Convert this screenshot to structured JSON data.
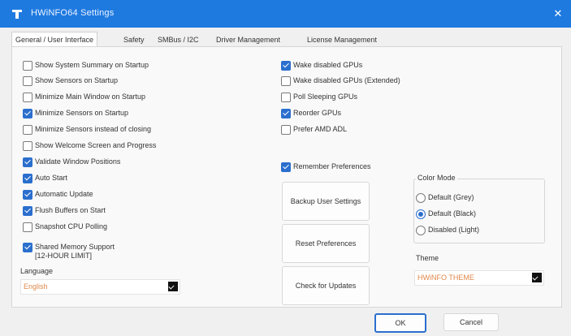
{
  "window": {
    "title": "HWiNFO64 Settings",
    "close_glyph": "✕",
    "accent": "#1f7ae0"
  },
  "tabs": [
    {
      "label": "General / User Interface"
    },
    {
      "label": "Safety"
    },
    {
      "label": "SMBus / I2C"
    },
    {
      "label": "Driver Management"
    },
    {
      "label": "License Management"
    }
  ],
  "left_options": [
    {
      "label": "Show System Summary on Startup",
      "checked": false
    },
    {
      "label": "Show Sensors on Startup",
      "checked": false
    },
    {
      "label": "Minimize Main Window on Startup",
      "checked": false
    },
    {
      "label": "Minimize Sensors on Startup",
      "checked": true
    },
    {
      "label": "Minimize Sensors instead of closing",
      "checked": false
    },
    {
      "label": "Show Welcome Screen and Progress",
      "checked": false
    },
    {
      "label": "Validate Window Positions",
      "checked": true
    },
    {
      "label": "Auto Start",
      "checked": true
    },
    {
      "label": "Automatic Update",
      "checked": true
    },
    {
      "label": "Flush Buffers on Start",
      "checked": true
    },
    {
      "label": "Snapshot CPU Polling",
      "checked": false
    },
    {
      "label": "Shared Memory Support",
      "checked": true
    }
  ],
  "shared_memory_note": "[12-HOUR LIMIT]",
  "right_options": [
    {
      "label": "Wake disabled GPUs",
      "checked": true
    },
    {
      "label": "Wake disabled GPUs (Extended)",
      "checked": false
    },
    {
      "label": "Poll Sleeping GPUs",
      "checked": false
    },
    {
      "label": "Reorder GPUs",
      "checked": true
    },
    {
      "label": "Prefer AMD ADL",
      "checked": false
    }
  ],
  "remember_preferences": {
    "label": "Remember Preferences",
    "checked": true
  },
  "buttons": {
    "backup": "Backup User Settings",
    "reset": "Reset Preferences",
    "check_updates": "Check for Updates"
  },
  "color_mode": {
    "title": "Color Mode",
    "options": [
      {
        "label": "Default (Grey)",
        "selected": false
      },
      {
        "label": "Default (Black)",
        "selected": true
      },
      {
        "label": "Disabled (Light)",
        "selected": false
      }
    ]
  },
  "theme": {
    "label": "Theme",
    "value": "HWiNFO THEME",
    "value_color": "#e0884a"
  },
  "language": {
    "label": "Language",
    "value": "English",
    "value_color": "#e0884a"
  },
  "footer": {
    "ok": "OK",
    "cancel": "Cancel"
  }
}
